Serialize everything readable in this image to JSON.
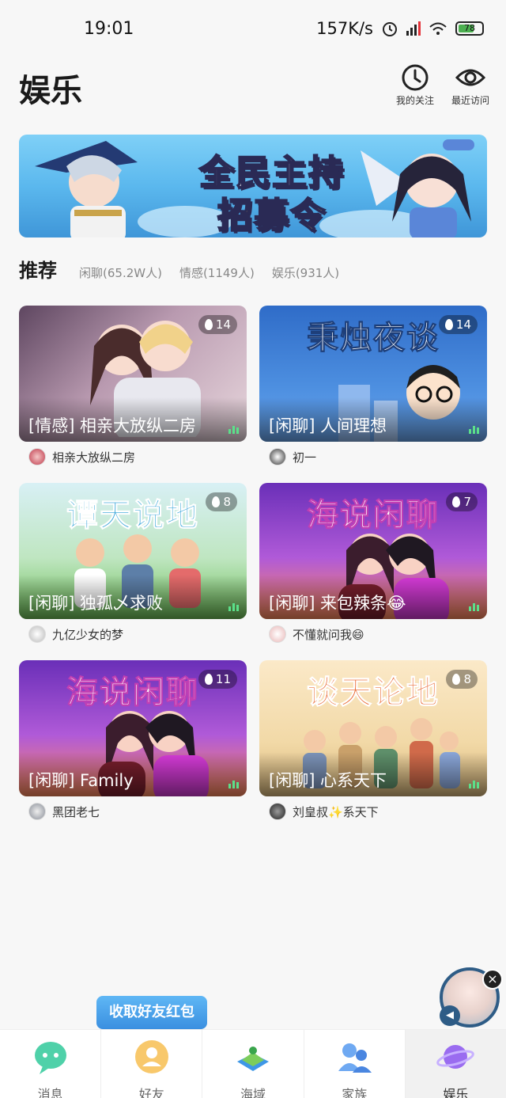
{
  "status_bar": {
    "time": "19:01",
    "net_speed": "157K/s",
    "battery": "78"
  },
  "header": {
    "title": "娱乐",
    "following_label": "我的关注",
    "recent_label": "最近访问"
  },
  "banner": {
    "line1": "全民主持",
    "line2": "招募令"
  },
  "tabs": {
    "main": "推荐",
    "items": [
      "闲聊(65.2W人)",
      "情感(1149人)",
      "娱乐(931人)"
    ]
  },
  "rooms": [
    {
      "title": "[情感] 相亲大放纵二房",
      "heat": "14",
      "owner": "相亲大放纵二房",
      "art": "",
      "color": "#c7a7b7"
    },
    {
      "title": "[闲聊] 人间理想",
      "heat": "14",
      "owner": "初一",
      "art": "秉烛夜谈",
      "color": "#3d79c9"
    },
    {
      "title": "[闲聊] 独孤乄求败",
      "heat": "8",
      "owner": "九亿少女的梦",
      "art": "谭天说地",
      "color": "#8fd26a"
    },
    {
      "title": "[闲聊] 来包辣条😂",
      "heat": "7",
      "owner": "不懂就问我😄",
      "art": "海说闲聊",
      "color": "#8a4ad0"
    },
    {
      "title": "[闲聊] Family",
      "heat": "11",
      "owner": "黑团老七",
      "art": "海说闲聊",
      "color": "#8a4ad0"
    },
    {
      "title": "[闲聊] 心系天下",
      "heat": "8",
      "owner": "刘皇叔✨系天下",
      "art": "谈天论地",
      "color": "#f2d9a7"
    }
  ],
  "red_packet": "收取好友红包",
  "bottom_nav": [
    {
      "label": "消息",
      "icon": "chat-bubble-icon"
    },
    {
      "label": "好友",
      "icon": "friend-icon"
    },
    {
      "label": "海域",
      "icon": "island-icon"
    },
    {
      "label": "家族",
      "icon": "family-icon"
    },
    {
      "label": "娱乐",
      "icon": "planet-icon"
    }
  ],
  "colors": {
    "accent": "#3a8fe0",
    "active_tab_bg": "#f1f1f1",
    "heat_badge": "rgba(0,0,0,.35)"
  }
}
